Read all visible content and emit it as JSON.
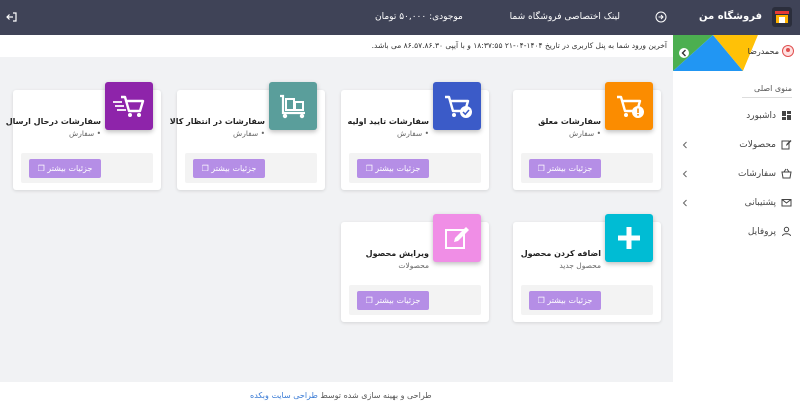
{
  "topbar": {
    "shop_link": "لینک اختصاصی فروشگاه شما",
    "balance": "موجودی: ۵۰,۰۰۰ تومان",
    "color": "#3f4357"
  },
  "sidebar": {
    "brand": "فروشگاه من",
    "user": "محمدرضا",
    "menu_title": "منوی اصلی",
    "items": [
      {
        "label": "داشبورد",
        "icon": "dashboard-icon"
      },
      {
        "label": "محصولات",
        "icon": "edit-icon"
      },
      {
        "label": "سفارشات",
        "icon": "basket-icon"
      },
      {
        "label": "پشتیبانی",
        "icon": "mail-icon"
      },
      {
        "label": "پروفایل",
        "icon": "user-icon"
      }
    ]
  },
  "info": "آخرین ورود شما به پنل کاربری در تاریخ ۱۴۰۴-۰۴-۲۱ ۱۸:۳۷:۵۵ و با آیپی ۸۶.۵۷.۸۶.۳۰ می باشد.",
  "cards": [
    {
      "title": "سفارشات معلق",
      "subtitle": "• سفارش",
      "button": "جزئیات بیشتر",
      "color": "#fb8c00",
      "icon": "cart-alert-icon"
    },
    {
      "title": "سفارشات تایید اولیه",
      "subtitle": "• سفارش",
      "button": "جزئیات بیشتر",
      "color": "#3b5bc8",
      "icon": "cart-check-icon"
    },
    {
      "title": "سفارشات در انتظار کالا",
      "subtitle": "• سفارش",
      "button": "جزئیات بیشتر",
      "color": "#5a9e9b",
      "icon": "dolly-icon"
    },
    {
      "title": "سفارشات درحال ارسال",
      "subtitle": "• سفارش",
      "button": "جزئیات بیشتر",
      "color": "#8e24aa",
      "icon": "fast-cart-icon"
    },
    {
      "title": "اضافه کردن محصول",
      "subtitle": "محصول جدید",
      "button": "جزئیات بیشتر",
      "color": "#00bcd4",
      "icon": "plus-icon"
    },
    {
      "title": "ویرایش محصول",
      "subtitle": "محصولات",
      "button": "جزئیات بیشتر",
      "color": "#f08ee6",
      "icon": "pencil-edit-icon"
    }
  ],
  "footer": {
    "text": "طراحی و بهینه سازی شده توسط",
    "link": "طراحی سایت وبکده"
  }
}
